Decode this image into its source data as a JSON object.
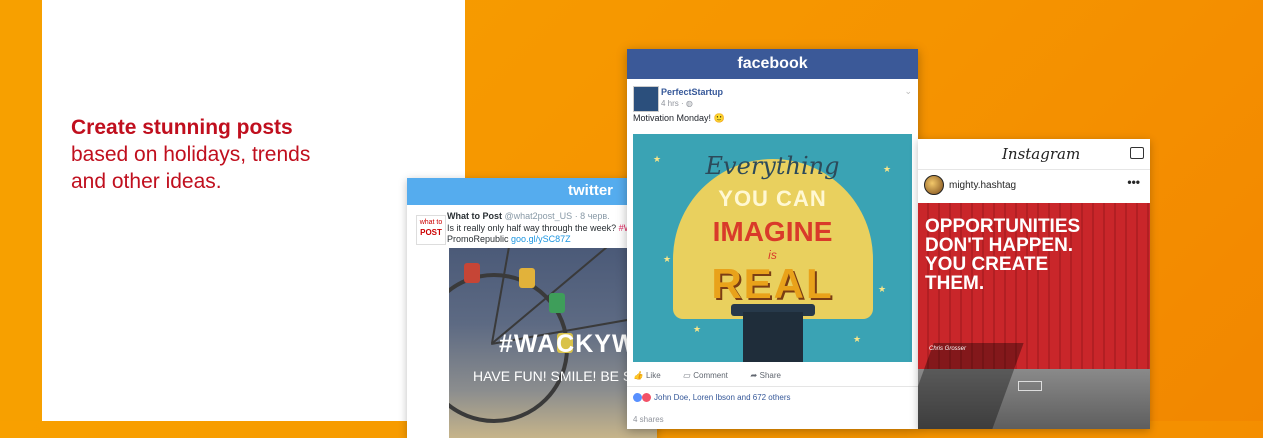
{
  "hero": {
    "headline_bold": "Create stunning posts",
    "headline_line2": "based on holidays, trends",
    "headline_line3": "and other ideas."
  },
  "colors": {
    "background": "#f59300",
    "headline": "#c00f1e",
    "twitter": "#55acee",
    "facebook": "#3b5998"
  },
  "twitter_card": {
    "brand": "twitter",
    "bird_icon": "twitter-bird-icon",
    "avatar_text_top": "what to",
    "avatar_text_main": "POST",
    "author_name": "What to Post",
    "author_handle": "@what2post_US · 8 черв.",
    "tweet_line1": "Is it really only half way through the week?",
    "tweet_hashtag": "#Wed",
    "tweet_line2_prefix": "PromoRepublic",
    "tweet_link": "goo.gl/ySC87Z",
    "image_hashtag": "#WACKYWEDN",
    "image_subtext": "HAVE FUN! SMILE! BE SILLY! GO"
  },
  "facebook_card": {
    "brand": "facebook",
    "page_name": "PerfectStartup",
    "post_time": "4 hrs · ◍",
    "post_text": "Motivation Monday! 🙂",
    "image_word1": "Everything",
    "image_word2": "YOU CAN",
    "image_word3": "IMAGINE",
    "image_word4": "is",
    "image_word5": "REAL",
    "actions": {
      "like": "Like",
      "comment": "Comment",
      "share": "Share"
    },
    "reactions_text": "John Doe, Loren Ibson and 672 others",
    "shares_text": "4 shares"
  },
  "instagram_card": {
    "brand": "Instagram",
    "username": "mighty.hashtag",
    "more_icon": "•••",
    "quote_lines": [
      "OPPORTUNITIES",
      "DON'T HAPPEN.",
      "YOU CREATE",
      "THEM."
    ],
    "quote_author": "Chris Grosser"
  }
}
